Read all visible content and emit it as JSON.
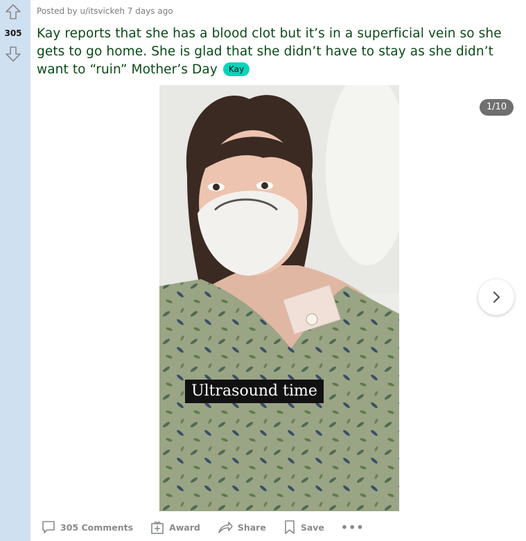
{
  "post": {
    "meta_prefix": "Posted by",
    "author": "u/itsvickeh",
    "age": "7 days ago",
    "title": "Kay reports that she has a blood clot but it’s in a superficial vein so she gets to go home. She is glad that she didn’t have to stay as she didn’t want to “ruin” Mother’s Day",
    "flair": "Kay",
    "flair_color": "#0dd3bb",
    "title_color": "#0a4a17"
  },
  "votes": {
    "score": "305",
    "up_icon": "arrow-up-outline-icon",
    "down_icon": "arrow-down-outline-icon"
  },
  "gallery": {
    "counter": "1/10",
    "caption": "Ultrasound time",
    "next_icon": "chevron-right-icon"
  },
  "actions": {
    "comments": "305 Comments",
    "award": "Award",
    "share": "Share",
    "save": "Save",
    "more": "•••"
  },
  "colors": {
    "rail": "#cfe0f1",
    "action_text": "#878a8c"
  }
}
